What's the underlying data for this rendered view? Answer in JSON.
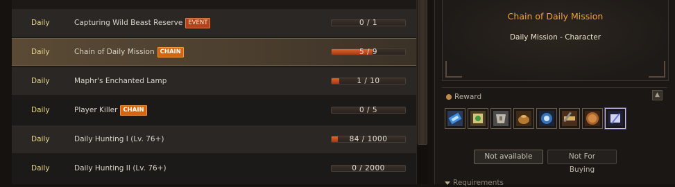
{
  "missions": [
    {
      "type": "Daily",
      "name": "Capturing Wild Beast Reserve",
      "badge": "EVENT",
      "badge_kind": "event",
      "progress": "0 / 1",
      "fraction": 0
    },
    {
      "type": "Daily",
      "name": "Chain of Daily Mission",
      "badge": "CHAIN",
      "badge_kind": "chain",
      "progress": "5 / 9",
      "fraction": 0.556
    },
    {
      "type": "Daily",
      "name": "Maphr's Enchanted Lamp",
      "badge": "",
      "badge_kind": "",
      "progress": "1 / 10",
      "fraction": 0.1
    },
    {
      "type": "Daily",
      "name": "Player Killer",
      "badge": "CHAIN",
      "badge_kind": "chain",
      "progress": "0 / 5",
      "fraction": 0
    },
    {
      "type": "Daily",
      "name": "Daily Hunting I (Lv. 76+)",
      "badge": "",
      "badge_kind": "",
      "progress": "84 / 1000",
      "fraction": 0.084
    },
    {
      "type": "Daily",
      "name": "Daily Hunting II (Lv. 76+)",
      "badge": "",
      "badge_kind": "",
      "progress": "0 / 2000",
      "fraction": 0
    }
  ],
  "selected_index": 1,
  "detail": {
    "title": "Chain of Daily Mission",
    "subtitle": "Daily Mission  -  Character",
    "reward_label": "Reward",
    "requirements_label": "Requirements",
    "rewards": [
      {
        "icon": "blue-ticket-icon"
      },
      {
        "icon": "scroll-gem-icon"
      },
      {
        "icon": "armor-chest-icon"
      },
      {
        "icon": "treasure-pouch-icon"
      },
      {
        "icon": "blue-rune-orb-icon"
      },
      {
        "icon": "weapon-scroll-icon"
      },
      {
        "icon": "bronze-coin-icon"
      },
      {
        "icon": "quill-scroll-icon"
      }
    ],
    "buttons": {
      "not_available": "Not available",
      "not_for_buying": "Not For Buying"
    }
  },
  "colors": {
    "accent": "#f0a42a",
    "type_text": "#e6d68e",
    "event_badge": "#b4421c",
    "chain_badge": "#d5650f",
    "bar_fill": "#d6551f"
  }
}
